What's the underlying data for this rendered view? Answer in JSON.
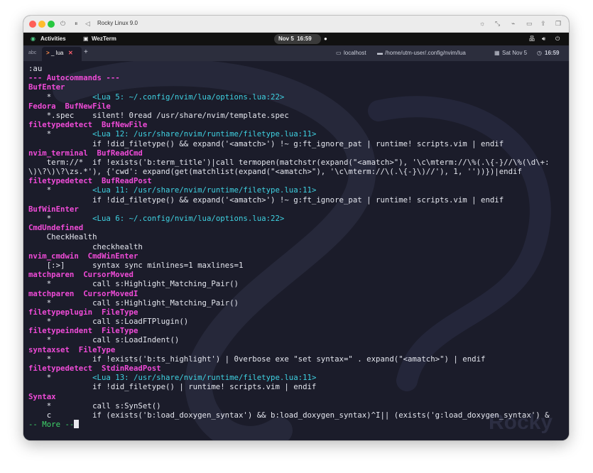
{
  "mac_window": {
    "title": "Rocky Linux 9.0",
    "traffic_lights": {
      "close": "#ff5f57",
      "minimize": "#febc2e",
      "zoom": "#28c840"
    }
  },
  "gnome_bar": {
    "activities": "Activities",
    "app_name": "WezTerm",
    "clock": "Nov 5  16:59"
  },
  "tab_bar": {
    "workspace": "abc",
    "tab_label": "_ lua",
    "new_tab": "+",
    "host": "localhost",
    "cwd": "/home/utm-user/.config/nvim/lua",
    "date": "Sat Nov 5",
    "time": "16:59"
  },
  "terminal": {
    "watermark": "Rocky",
    "lines": [
      [
        {
          "t": ":au",
          "c": ""
        }
      ],
      [
        {
          "t": "--- Autocommands ---",
          "c": "mag"
        }
      ],
      [
        {
          "t": "BufEnter",
          "c": "mag"
        }
      ],
      [
        {
          "t": "    *         ",
          "c": ""
        },
        {
          "t": "<Lua 5: ~/.config/nvim/lua/options.lua:22>",
          "c": "cy"
        }
      ],
      [
        {
          "t": "Fedora  BufNewFile",
          "c": "mag"
        }
      ],
      [
        {
          "t": "    *.spec    silent! 0read /usr/share/nvim/template.spec",
          "c": ""
        }
      ],
      [
        {
          "t": "filetypedetect  BufNewFile",
          "c": "mag"
        }
      ],
      [
        {
          "t": "    *         ",
          "c": ""
        },
        {
          "t": "<Lua 12: /usr/share/nvim/runtime/filetype.lua:11>",
          "c": "cy"
        }
      ],
      [
        {
          "t": "              if !did_filetype() && expand('<amatch>') !~ g:ft_ignore_pat | runtime! scripts.vim | endif",
          "c": ""
        }
      ],
      [
        {
          "t": "nvim_terminal  BufReadCmd",
          "c": "mag"
        }
      ],
      [
        {
          "t": "    term://*  if !exists('b:term_title')|call termopen(matchstr(expand(\"<amatch>\"), '\\c\\mterm://\\%(.\\{-}//\\%(\\d\\+:",
          "c": ""
        }
      ],
      [
        {
          "t": "\\)\\?\\)\\?\\zs.*'), {'cwd': expand(get(matchlist(expand(\"<amatch>\"), '\\c\\mterm://\\(.\\{-}\\)//'), 1, ''))})|endif",
          "c": ""
        }
      ],
      [
        {
          "t": "filetypedetect  BufReadPost",
          "c": "mag"
        }
      ],
      [
        {
          "t": "    *         ",
          "c": ""
        },
        {
          "t": "<Lua 11: /usr/share/nvim/runtime/filetype.lua:11>",
          "c": "cy"
        }
      ],
      [
        {
          "t": "              if !did_filetype() && expand('<amatch>') !~ g:ft_ignore_pat | runtime! scripts.vim | endif",
          "c": ""
        }
      ],
      [
        {
          "t": "BufWinEnter",
          "c": "mag"
        }
      ],
      [
        {
          "t": "    *         ",
          "c": ""
        },
        {
          "t": "<Lua 6: ~/.config/nvim/lua/options.lua:22>",
          "c": "cy"
        }
      ],
      [
        {
          "t": "CmdUndefined",
          "c": "mag"
        }
      ],
      [
        {
          "t": "    CheckHealth",
          "c": ""
        }
      ],
      [
        {
          "t": "              checkhealth",
          "c": ""
        }
      ],
      [
        {
          "t": "nvim_cmdwin  CmdWinEnter",
          "c": "mag"
        }
      ],
      [
        {
          "t": "    [:>]      syntax sync minlines=1 maxlines=1",
          "c": ""
        }
      ],
      [
        {
          "t": "matchparen  CursorMoved",
          "c": "mag"
        }
      ],
      [
        {
          "t": "    *         call s:Highlight_Matching_Pair()",
          "c": ""
        }
      ],
      [
        {
          "t": "matchparen  CursorMovedI",
          "c": "mag"
        }
      ],
      [
        {
          "t": "    *         call s:Highlight_Matching_Pair()",
          "c": ""
        }
      ],
      [
        {
          "t": "filetypeplugin  FileType",
          "c": "mag"
        }
      ],
      [
        {
          "t": "    *         call s:LoadFTPlugin()",
          "c": ""
        }
      ],
      [
        {
          "t": "filetypeindent  FileType",
          "c": "mag"
        }
      ],
      [
        {
          "t": "    *         call s:LoadIndent()",
          "c": ""
        }
      ],
      [
        {
          "t": "syntaxset  FileType",
          "c": "mag"
        }
      ],
      [
        {
          "t": "    *         if !exists('b:ts_highlight') | 0verbose exe \"set syntax=\" . expand(\"<amatch>\") | endif",
          "c": ""
        }
      ],
      [
        {
          "t": "filetypedetect  StdinReadPost",
          "c": "mag"
        }
      ],
      [
        {
          "t": "    *         ",
          "c": ""
        },
        {
          "t": "<Lua 13: /usr/share/nvim/runtime/filetype.lua:11>",
          "c": "cy"
        }
      ],
      [
        {
          "t": "              if !did_filetype() | runtime! scripts.vim | endif",
          "c": ""
        }
      ],
      [
        {
          "t": "Syntax",
          "c": "mag"
        }
      ],
      [
        {
          "t": "    *         call s:SynSet()",
          "c": ""
        }
      ],
      [
        {
          "t": "    c         if (exists('b:load_doxygen_syntax') && b:load_doxygen_syntax)^I|| (exists('g:load_doxygen_syntax') &",
          "c": ""
        }
      ]
    ],
    "more_prompt": "-- More --"
  }
}
